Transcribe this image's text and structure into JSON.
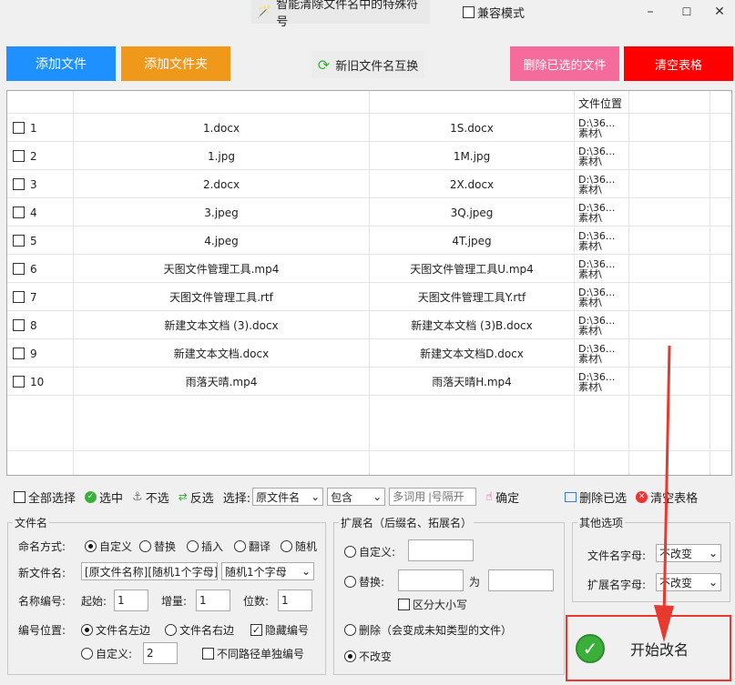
{
  "window": {
    "title": "智能清除文件名中的特殊符号",
    "compat_label": "兼容模式",
    "min": "–",
    "max": "☐",
    "close": "✕"
  },
  "top_buttons": {
    "add_file": "添加文件",
    "add_folder": "添加文件夹",
    "swap_names": "新旧文件名互换",
    "delete_selected": "删除已选的文件",
    "clear_table": "清空表格"
  },
  "colors": {
    "blue": "#1e90ff",
    "orange": "#f0981a",
    "pink": "#f56b9b",
    "red": "#ff0000",
    "green": "#3ab03a",
    "annotation_red": "#e8392f"
  },
  "table": {
    "header_location": "文件位置",
    "rows": [
      {
        "num": "1",
        "old": "1.docx",
        "new": "1S.docx",
        "loc1": "D:\\36...",
        "loc2": "素材\\"
      },
      {
        "num": "2",
        "old": "1.jpg",
        "new": "1M.jpg",
        "loc1": "D:\\36...",
        "loc2": "素材\\"
      },
      {
        "num": "3",
        "old": "2.docx",
        "new": "2X.docx",
        "loc1": "D:\\36...",
        "loc2": "素材\\"
      },
      {
        "num": "4",
        "old": "3.jpeg",
        "new": "3Q.jpeg",
        "loc1": "D:\\36...",
        "loc2": "素材\\"
      },
      {
        "num": "5",
        "old": "4.jpeg",
        "new": "4T.jpeg",
        "loc1": "D:\\36...",
        "loc2": "素材\\"
      },
      {
        "num": "6",
        "old": "天图文件管理工具.mp4",
        "new": "天图文件管理工具U.mp4",
        "loc1": "D:\\36...",
        "loc2": "素材\\"
      },
      {
        "num": "7",
        "old": "天图文件管理工具.rtf",
        "new": "天图文件管理工具Y.rtf",
        "loc1": "D:\\36...",
        "loc2": "素材\\"
      },
      {
        "num": "8",
        "old": "新建文本文档 (3).docx",
        "new": "新建文本文档 (3)B.docx",
        "loc1": "D:\\36...",
        "loc2": "素材\\"
      },
      {
        "num": "9",
        "old": "新建文本文档.docx",
        "new": "新建文本文档D.docx",
        "loc1": "D:\\36...",
        "loc2": "素材\\"
      },
      {
        "num": "10",
        "old": "雨落天晴.mp4",
        "new": "雨落天晴H.mp4",
        "loc1": "D:\\36...",
        "loc2": "素材\\"
      }
    ]
  },
  "toolbar": {
    "select_all": "全部选择",
    "select": "选中",
    "deselect": "不选",
    "invert": "反选",
    "choose_label": "选择:",
    "field_value": "原文件名",
    "match_value": "包含",
    "keyword_placeholder": "多词用 |号隔开",
    "confirm": "确定",
    "delete_selected": "删除已选",
    "clear_table": "清空表格"
  },
  "filename_group": {
    "title": "文件名",
    "mode_label": "命名方式:",
    "modes": [
      "自定义",
      "替换",
      "插入",
      "翻译",
      "随机"
    ],
    "new_name_label": "新文件名:",
    "new_name_value": "[原文件名称][随机1个字母]",
    "new_name_combo": "随机1个字母",
    "numbering_label": "名称编号:",
    "start_label": "起始:",
    "start_value": "1",
    "step_label": "增量:",
    "step_value": "1",
    "digits_label": "位数:",
    "digits_value": "1",
    "position_label": "编号位置:",
    "pos_left": "文件名左边",
    "pos_right": "文件名右边",
    "hide_number": "隐藏编号",
    "custom_label": "自定义:",
    "custom_value": "2",
    "separate_paths": "不同路径单独编号"
  },
  "ext_group": {
    "title": "扩展名（后缀名、拓展名）",
    "custom": "自定义:",
    "replace": "替换:",
    "to": "为",
    "case_sensitive": "区分大小写",
    "delete": "删除（会变成未知类型的文件）",
    "unchanged": "不改变"
  },
  "other_group": {
    "title": "其他选项",
    "filename_case_label": "文件名字母:",
    "filename_case_value": "不改变",
    "ext_case_label": "扩展名字母:",
    "ext_case_value": "不改变"
  },
  "start_button": "开始改名"
}
